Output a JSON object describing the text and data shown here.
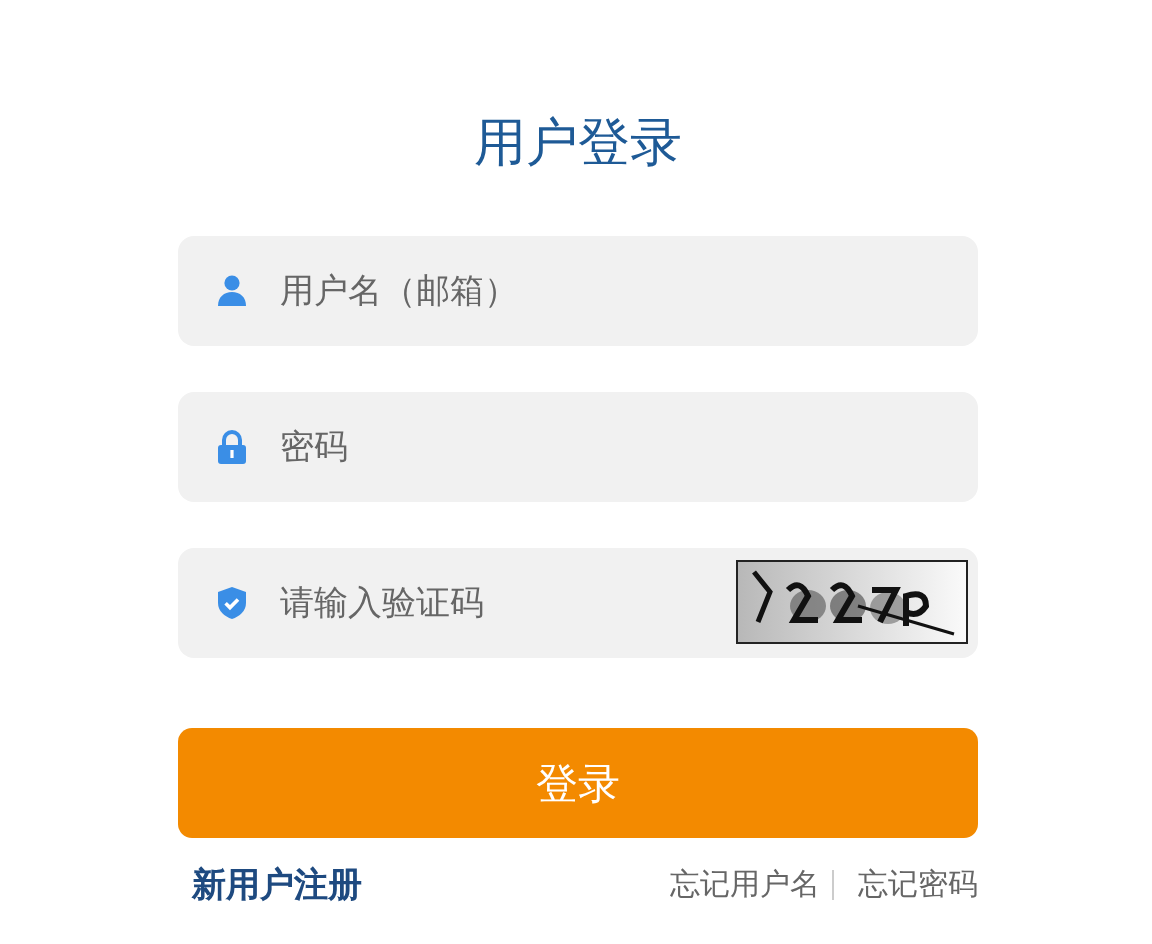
{
  "title": "用户登录",
  "fields": [
    {
      "kind": "user",
      "placeholder": "用户名（邮箱）"
    },
    {
      "kind": "password",
      "placeholder": "密码"
    },
    {
      "kind": "captcha",
      "placeholder": "请输入验证码"
    }
  ],
  "submit": "登录",
  "register_link": "新用户注册",
  "forgot_links": [
    "忘记用户名",
    "忘记密码"
  ]
}
